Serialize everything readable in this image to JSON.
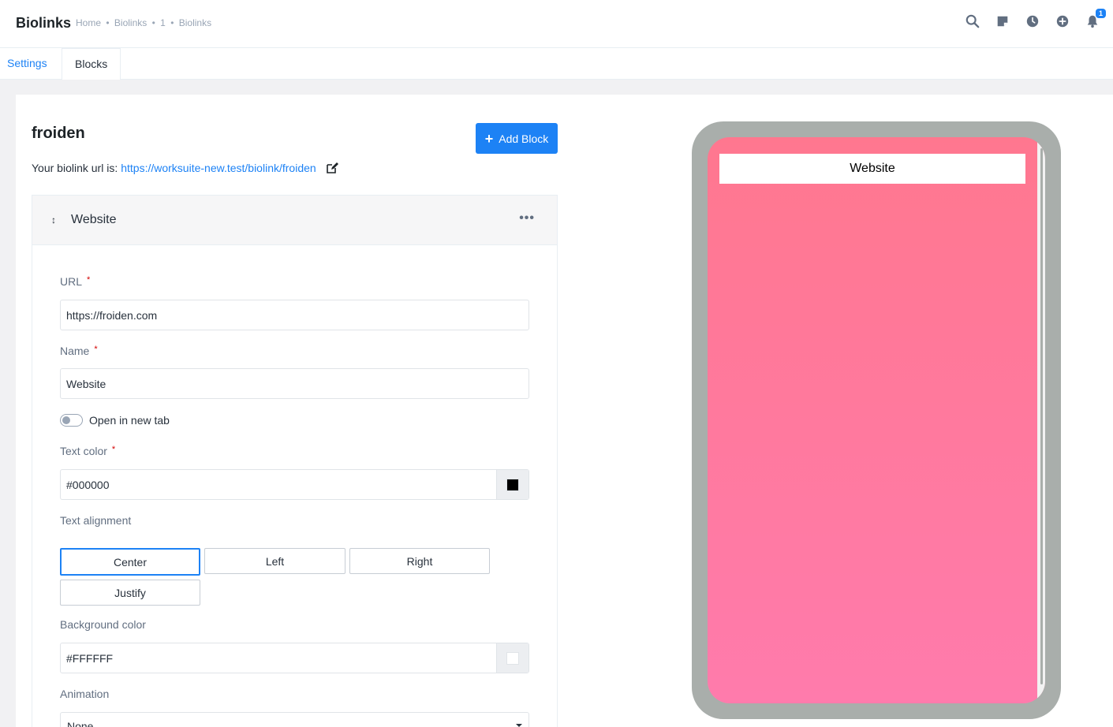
{
  "header": {
    "title": "Biolinks",
    "breadcrumb": [
      "Home",
      "•",
      "Biolinks",
      "•",
      "1",
      "•",
      "Biolinks"
    ],
    "icons": [
      "search-icon",
      "sticky-note-icon",
      "clock-icon",
      "add-circle-icon",
      "bell-icon"
    ],
    "notification_count": "1"
  },
  "tabs": [
    {
      "label": "Settings",
      "active": false
    },
    {
      "label": "Blocks",
      "active": true
    }
  ],
  "page": {
    "title": "froiden",
    "add_block_label": "Add Block",
    "biolink_url_label": "Your biolink url is:",
    "biolink_url": "https://worksuite-new.test/biolink/froiden"
  },
  "block": {
    "name": "Website",
    "url_label": "URL",
    "url_value": "https://froiden.com",
    "name_label": "Name",
    "name_value": "Website",
    "new_tab_label": "Open in new tab",
    "new_tab_checked": false,
    "text_color_label": "Text color",
    "text_color_value": "#000000",
    "text_alignment_label": "Text alignment",
    "alignments": [
      "Center",
      "Left",
      "Right",
      "Justify"
    ],
    "selected_alignment": "Center",
    "bg_color_label": "Background color",
    "bg_color_value": "#FFFFFF",
    "animation_label": "Animation",
    "animation_value": "None",
    "required_mark": "*"
  },
  "preview": {
    "link_label": "Website",
    "gradient_top": "#ff778f",
    "gradient_bottom": "#ff7bac"
  },
  "colors": {
    "accent": "#1d82f5",
    "phone_frame": "#a9aeab"
  }
}
